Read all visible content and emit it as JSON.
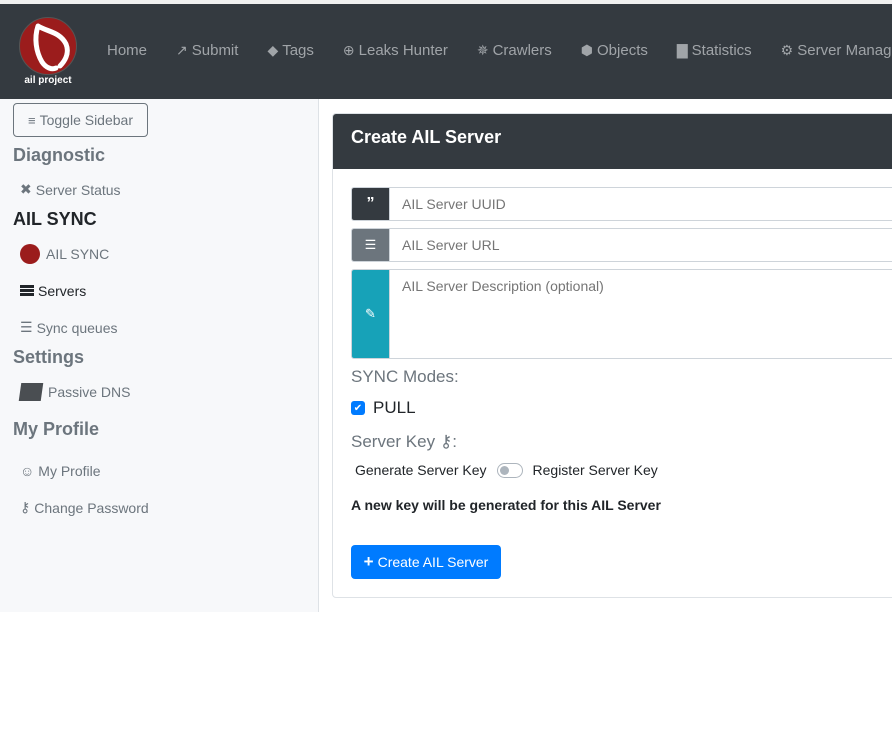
{
  "logo": {
    "text": "ail project"
  },
  "nav": {
    "items": [
      {
        "label": "Home",
        "icon": ""
      },
      {
        "label": "Submit",
        "icon": "external-link-icon"
      },
      {
        "label": "Tags",
        "icon": "tag-icon"
      },
      {
        "label": "Leaks Hunter",
        "icon": "crosshairs-icon"
      },
      {
        "label": "Crawlers",
        "icon": "spider-icon"
      },
      {
        "label": "Objects",
        "icon": "cube-icon"
      },
      {
        "label": "Statistics",
        "icon": "chart-bar-icon"
      },
      {
        "label": "Server Manage",
        "icon": "gear-icon"
      }
    ]
  },
  "sidebar": {
    "toggle_label": "Toggle Sidebar",
    "sections": [
      {
        "title": "Diagnostic",
        "items": [
          {
            "label": "Server Status",
            "icon": "tools-icon"
          }
        ]
      },
      {
        "title": "AIL SYNC",
        "items": [
          {
            "label": "AIL SYNC",
            "icon": "ail-sync-logo-icon"
          },
          {
            "label": "Servers",
            "icon": "server-icon",
            "active": true
          },
          {
            "label": "Sync queues",
            "icon": "list-icon"
          }
        ]
      },
      {
        "title": "Settings",
        "items": [
          {
            "label": "Passive DNS",
            "icon": "passive-dns-icon"
          }
        ]
      },
      {
        "title": "My Profile",
        "items": [
          {
            "label": "My Profile",
            "icon": "user-edit-icon"
          },
          {
            "label": "Change Password",
            "icon": "key-icon"
          }
        ]
      }
    ]
  },
  "form": {
    "title": "Create AIL Server",
    "uuid_placeholder": "AIL Server UUID",
    "url_placeholder": "AIL Server URL",
    "description_placeholder": "AIL Server Description (optional)",
    "sync_modes_label": "SYNC Modes:",
    "pull_label": "PULL",
    "pull_checked": true,
    "server_key_label": "Server Key",
    "server_key_suffix": ":",
    "generate_key_label": "Generate Server Key",
    "register_key_label": "Register Server Key",
    "register_toggle_on": false,
    "key_note": "A new key will be generated for this AIL Server",
    "submit_label": "Create AIL Server"
  },
  "colors": {
    "navbar": "#343a40",
    "primary": "#007bff",
    "info": "#17a2b8",
    "logo_red": "#9b1c1c"
  }
}
